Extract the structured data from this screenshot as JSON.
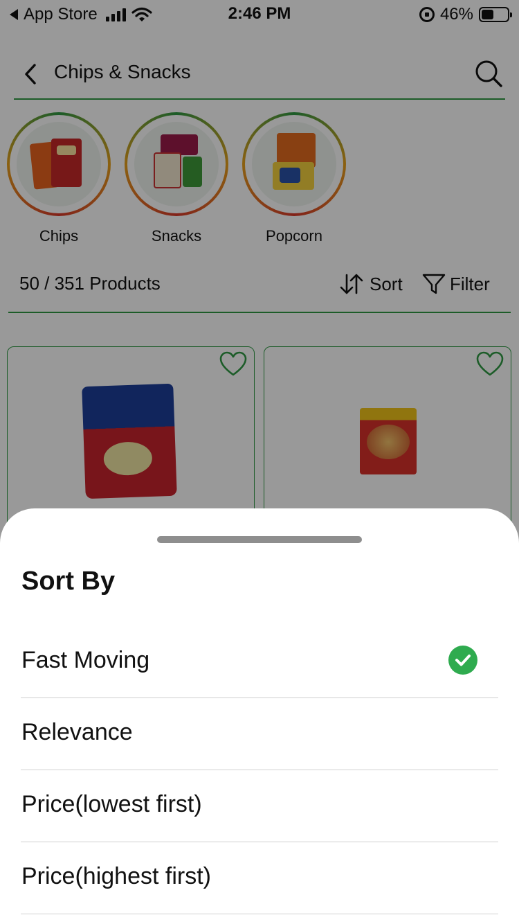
{
  "status_bar": {
    "back_app": "App Store",
    "time": "2:46 PM",
    "battery": "46%",
    "battery_level": 0.46
  },
  "header": {
    "title": "Chips & Snacks"
  },
  "categories": [
    {
      "label": "Chips"
    },
    {
      "label": "Snacks"
    },
    {
      "label": "Popcorn"
    }
  ],
  "list": {
    "count": "50 / 351 Products",
    "sort_label": "Sort",
    "filter_label": "Filter"
  },
  "colors": {
    "accent_green": "#2f9a44",
    "check_green": "#2fab4f"
  },
  "sheet": {
    "title": "Sort By",
    "options": [
      {
        "label": "Fast Moving",
        "selected": true
      },
      {
        "label": "Relevance",
        "selected": false
      },
      {
        "label": "Price(lowest first)",
        "selected": false
      },
      {
        "label": "Price(highest first)",
        "selected": false
      }
    ]
  }
}
